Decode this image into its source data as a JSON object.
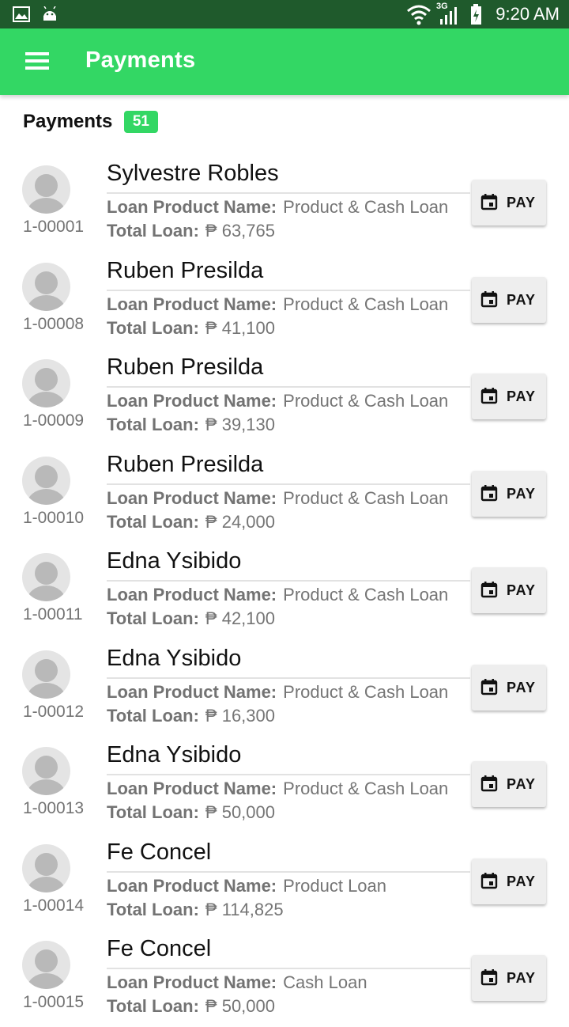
{
  "status_bar": {
    "time": "9:20 AM",
    "network": "3G",
    "icons": [
      "gallery-icon",
      "android-icon",
      "wifi-icon",
      "signal-icon",
      "battery-icon"
    ]
  },
  "app_bar": {
    "title": "Payments",
    "menu_icon": "menu-icon"
  },
  "section": {
    "title": "Payments",
    "count": "51"
  },
  "labels": {
    "product": "Loan Product Name:",
    "total": "Total Loan:",
    "pay": "PAY"
  },
  "colors": {
    "primary": "#33d764",
    "status_bar": "#1f5a2c",
    "button_bg": "#eeeeee"
  },
  "items": [
    {
      "account": "1-00001",
      "name": "Sylvestre Robles",
      "product": "Product & Cash Loan",
      "total": "₱ 63,765"
    },
    {
      "account": "1-00008",
      "name": "Ruben Presilda",
      "product": "Product & Cash Loan",
      "total": "₱ 41,100"
    },
    {
      "account": "1-00009",
      "name": "Ruben Presilda",
      "product": "Product & Cash Loan",
      "total": "₱ 39,130"
    },
    {
      "account": "1-00010",
      "name": "Ruben Presilda",
      "product": "Product & Cash Loan",
      "total": "₱ 24,000"
    },
    {
      "account": "1-00011",
      "name": "Edna Ysibido",
      "product": "Product & Cash Loan",
      "total": "₱ 42,100"
    },
    {
      "account": "1-00012",
      "name": "Edna Ysibido",
      "product": "Product & Cash Loan",
      "total": "₱ 16,300"
    },
    {
      "account": "1-00013",
      "name": "Edna Ysibido",
      "product": "Product & Cash Loan",
      "total": "₱ 50,000"
    },
    {
      "account": "1-00014",
      "name": "Fe Concel",
      "product": "Product Loan",
      "total": "₱ 114,825"
    },
    {
      "account": "1-00015",
      "name": "Fe Concel",
      "product": "Cash Loan",
      "total": "₱ 50,000"
    }
  ]
}
